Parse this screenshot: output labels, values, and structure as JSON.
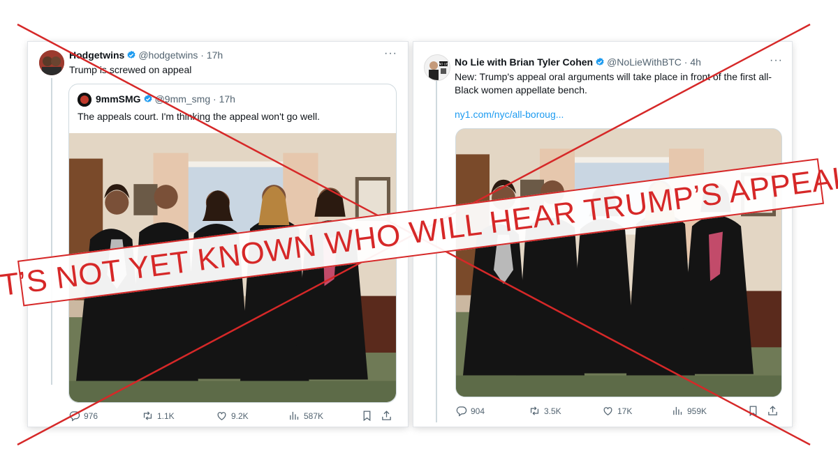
{
  "left_post": {
    "author_name": "Hodgetwins",
    "handle": "@hodgetwins",
    "time": "· 17h",
    "text": "Trump is screwed on appeal",
    "more": "···",
    "quote": {
      "author_name": "9mmSMG",
      "handle": "@9mm_smg",
      "time": "· 17h",
      "text": "The appeals court. I'm thinking the appeal won't go well."
    },
    "actions": {
      "replies": "976",
      "reposts": "1.1K",
      "likes": "9.2K",
      "views": "587K"
    }
  },
  "right_post": {
    "author_name": "No Lie with Brian Tyler Cohen",
    "handle": "@NoLieWithBTC",
    "time": "· 4h",
    "text_line1": "New: Trump's appeal oral arguments will take place in front of the first all-",
    "text_line2": "Black women appellate bench.",
    "link": "ny1.com/nyc/all-boroug...",
    "more": "···",
    "avatar_text": "NO LIE",
    "actions": {
      "replies": "904",
      "reposts": "3.5K",
      "likes": "17K",
      "views": "959K"
    }
  },
  "overlay": {
    "banner_text": "IT’S NOT YET KNOWN WHO WILL HEAR TRUMP’S APPEAL",
    "accent_color": "#d62828"
  },
  "colors": {
    "verified": "#1d9bf0",
    "secondary_text": "#536471",
    "link": "#1d9bf0"
  },
  "icons": [
    "more-icon",
    "verified-icon",
    "reply-icon",
    "repost-icon",
    "like-icon",
    "views-icon",
    "bookmark-icon",
    "share-icon"
  ]
}
